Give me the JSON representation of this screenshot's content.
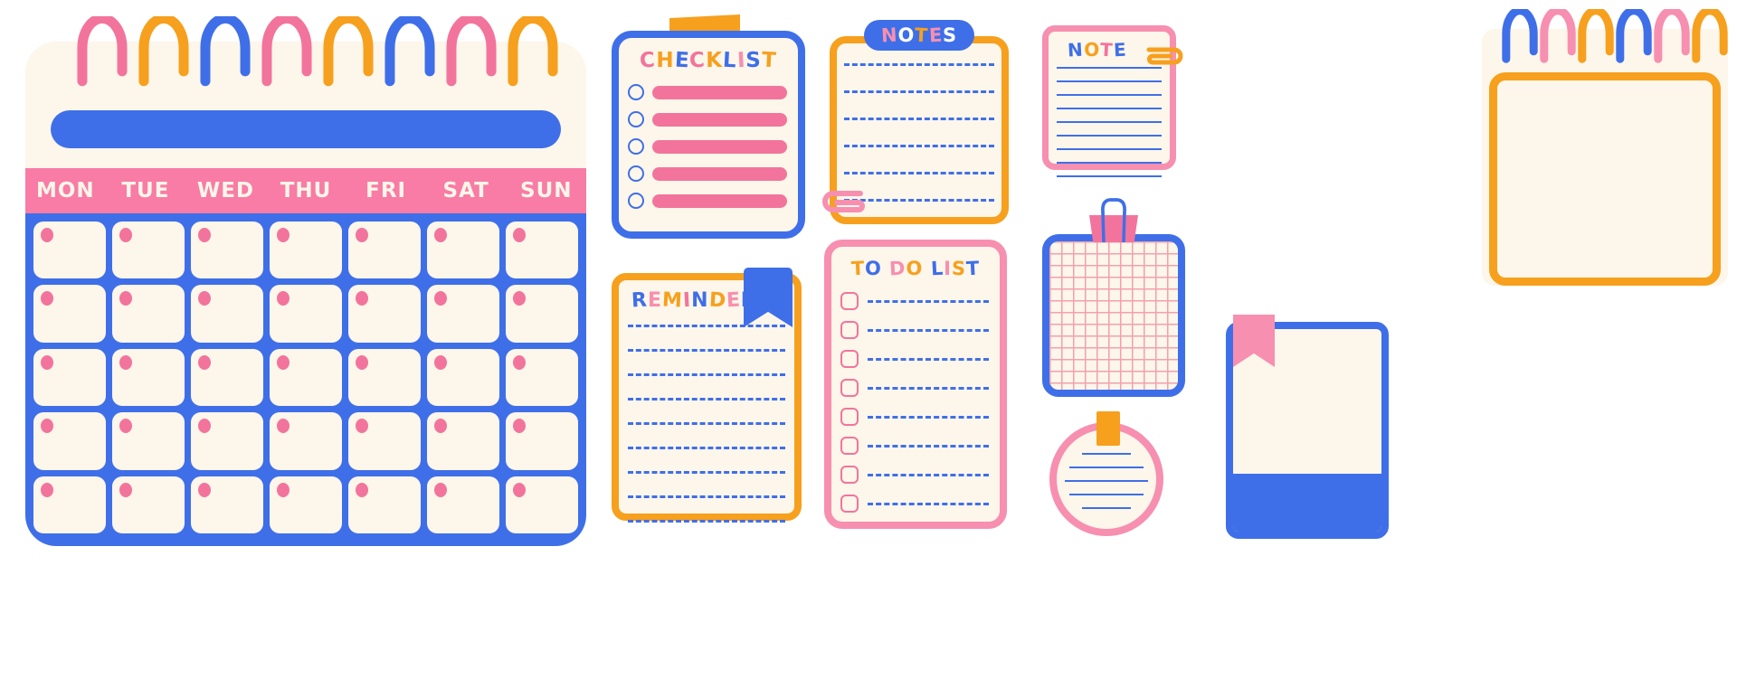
{
  "palette": {
    "blue": "#3f6fe8",
    "pink": "#f2749c",
    "light_pink": "#f78fb0",
    "orange": "#f6a01e",
    "cream": "#fdf6ea",
    "white": "#ffffff"
  },
  "calendar": {
    "name": "monthly-calendar",
    "day_headers": [
      "MON",
      "TUE",
      "WED",
      "THU",
      "FRI",
      "SAT",
      "SUN"
    ],
    "rows": 5,
    "columns": 7,
    "cell_count": 35,
    "spiral_colors": [
      "#f2749c",
      "#f6a01e",
      "#3f6fe8",
      "#f2749c",
      "#f6a01e",
      "#3f6fe8",
      "#f2749c",
      "#f6a01e"
    ],
    "title_bar_color": "#3f6fe8",
    "header_band_color": "#f87ca5",
    "grid_color": "#3f6fe8",
    "dot_color": "#f2749c"
  },
  "checklist": {
    "title": "CHECKLIST",
    "title_letter_colors": [
      "#f2749c",
      "#f6a01e",
      "#3f6fe8",
      "#f2749c",
      "#f6a01e",
      "#3f6fe8",
      "#f78fb0",
      "#3f6fe8",
      "#f6a01e"
    ],
    "border_color": "#3f6fe8",
    "tape_color": "#f6a01e",
    "rows": 5,
    "checkbox_shape": "circle",
    "bar_color": "#f2749c"
  },
  "notes": {
    "title": "NOTES",
    "title_letter_colors": [
      "#f78fb0",
      "#ffffff",
      "#f6a01e",
      "#f78fb0",
      "#ffffff"
    ],
    "pill_color": "#3f6fe8",
    "border_color": "#f6a01e",
    "line_count": 6,
    "line_style": "dashed",
    "line_color": "#3f6fe8",
    "clip_color": "#f78fb0",
    "clip_position": "bottom-left"
  },
  "note": {
    "title": "NOTE",
    "title_letter_colors": [
      "#3f6fe8",
      "#f6a01e",
      "#f2749c",
      "#3f6fe8"
    ],
    "border_color": "#f78fb0",
    "line_count": 9,
    "line_style": "solid",
    "line_color": "#3f6fe8",
    "clip_color": "#f6a01e",
    "clip_position": "top-right"
  },
  "big_spiral_card": {
    "name": "blank-spiral-notepad",
    "spiral_colors": [
      "#3f6fe8",
      "#f78fb0",
      "#f6a01e",
      "#3f6fe8",
      "#f78fb0",
      "#f6a01e"
    ],
    "border_color": "#f6a01e",
    "body_color": "#fdf6ea"
  },
  "reminder": {
    "title": "REMINDER",
    "title_letter_colors": [
      "#3f6fe8",
      "#f78fb0",
      "#f6a01e",
      "#f2749c",
      "#3f6fe8",
      "#f6a01e",
      "#f78fb0",
      "#3f6fe8"
    ],
    "border_color": "#f6a01e",
    "ribbon_color": "#3f6fe8",
    "line_count": 9,
    "line_style": "dashed",
    "line_color": "#3f6fe8"
  },
  "todo": {
    "title": "TO DO LIST",
    "title_letter_colors": [
      "#f6a01e",
      "#3f6fe8",
      "#f78fb0",
      "#f6a01e",
      "#3f6fe8",
      "#f78fb0",
      "#f6a01e",
      "#3f6fe8"
    ],
    "border_color": "#f78fb0",
    "rows": 8,
    "checkbox_shape": "rounded-square",
    "checkbox_color": "#f2749c",
    "line_style": "dashed",
    "line_color": "#3f6fe8"
  },
  "grid_card": {
    "name": "grid-paper-card",
    "border_color": "#3f6fe8",
    "grid_color": "#f2a0ae",
    "clip_body_color": "#f2749c",
    "clip_wire_color": "#3f6fe8"
  },
  "circle_note": {
    "name": "circle-note",
    "border_color": "#f78fb0",
    "tape_color": "#f6a01e",
    "line_count": 5,
    "line_style": "solid",
    "line_color": "#3f6fe8"
  },
  "bookmark_card": {
    "name": "bookmark-card",
    "border_color": "#3f6fe8",
    "ribbon_color": "#f78fb0",
    "bottom_band_color": "#3f6fe8"
  }
}
